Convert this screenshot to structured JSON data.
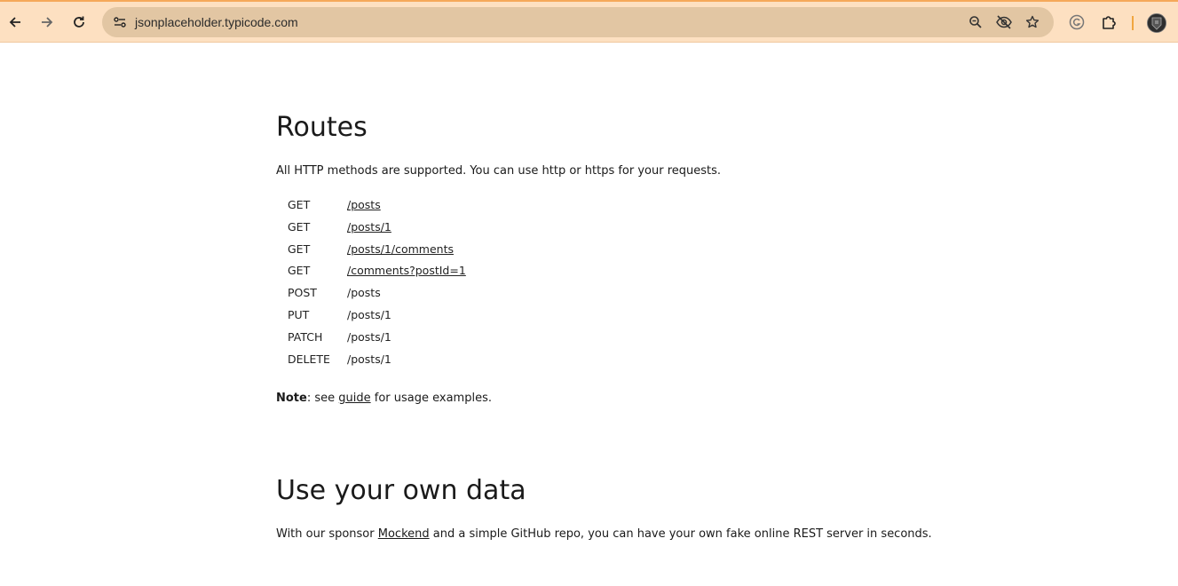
{
  "browser": {
    "url": "jsonplaceholder.typicode.com",
    "accent_color": "#f5a85a",
    "toolbar_color": "#fde0c1",
    "icons": [
      "back-icon",
      "forward-icon",
      "reload-icon",
      "site-info-icon",
      "zoom-icon",
      "eye-off-icon",
      "star-icon",
      "grammarly-icon",
      "extensions-icon",
      "profile-avatar"
    ]
  },
  "routes_section": {
    "title": "Routes",
    "intro": "All HTTP methods are supported. You can use http or https for your requests.",
    "routes": [
      {
        "method": "GET",
        "path": "/posts",
        "link": true
      },
      {
        "method": "GET",
        "path": "/posts/1",
        "link": true
      },
      {
        "method": "GET",
        "path": "/posts/1/comments",
        "link": true
      },
      {
        "method": "GET",
        "path": "/comments?postId=1",
        "link": true
      },
      {
        "method": "POST",
        "path": "/posts",
        "link": false
      },
      {
        "method": "PUT",
        "path": "/posts/1",
        "link": false
      },
      {
        "method": "PATCH",
        "path": "/posts/1",
        "link": false
      },
      {
        "method": "DELETE",
        "path": "/posts/1",
        "link": false
      }
    ],
    "note_label": "Note",
    "note_prefix": ": see ",
    "note_link": "guide",
    "note_suffix": " for usage examples."
  },
  "own_data_section": {
    "title": "Use your own data",
    "text_prefix": "With our sponsor ",
    "link": "Mockend",
    "text_suffix": " and a simple GitHub repo, you can have your own fake online REST server in seconds."
  }
}
